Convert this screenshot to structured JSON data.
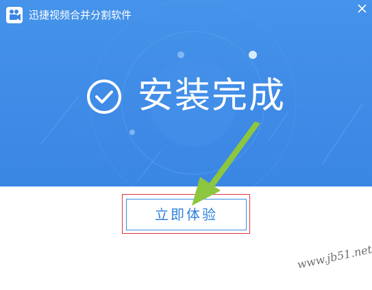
{
  "window": {
    "title": "迅捷视频合并分割软件",
    "app_icon": "film-camera-icon",
    "close_icon": "close-icon"
  },
  "banner": {
    "status_text": "安装完成",
    "status_icon": "checkmark-circle-icon",
    "background_color": "#4090e8"
  },
  "action": {
    "primary_label": "立即体验",
    "accent_color": "#2d7fdc"
  },
  "annotation": {
    "arrow_icon": "green-arrow-icon",
    "highlight_color": "#d9363e",
    "arrow_color": "#8dc63f"
  },
  "watermark": {
    "text": "www.jb51.net"
  }
}
